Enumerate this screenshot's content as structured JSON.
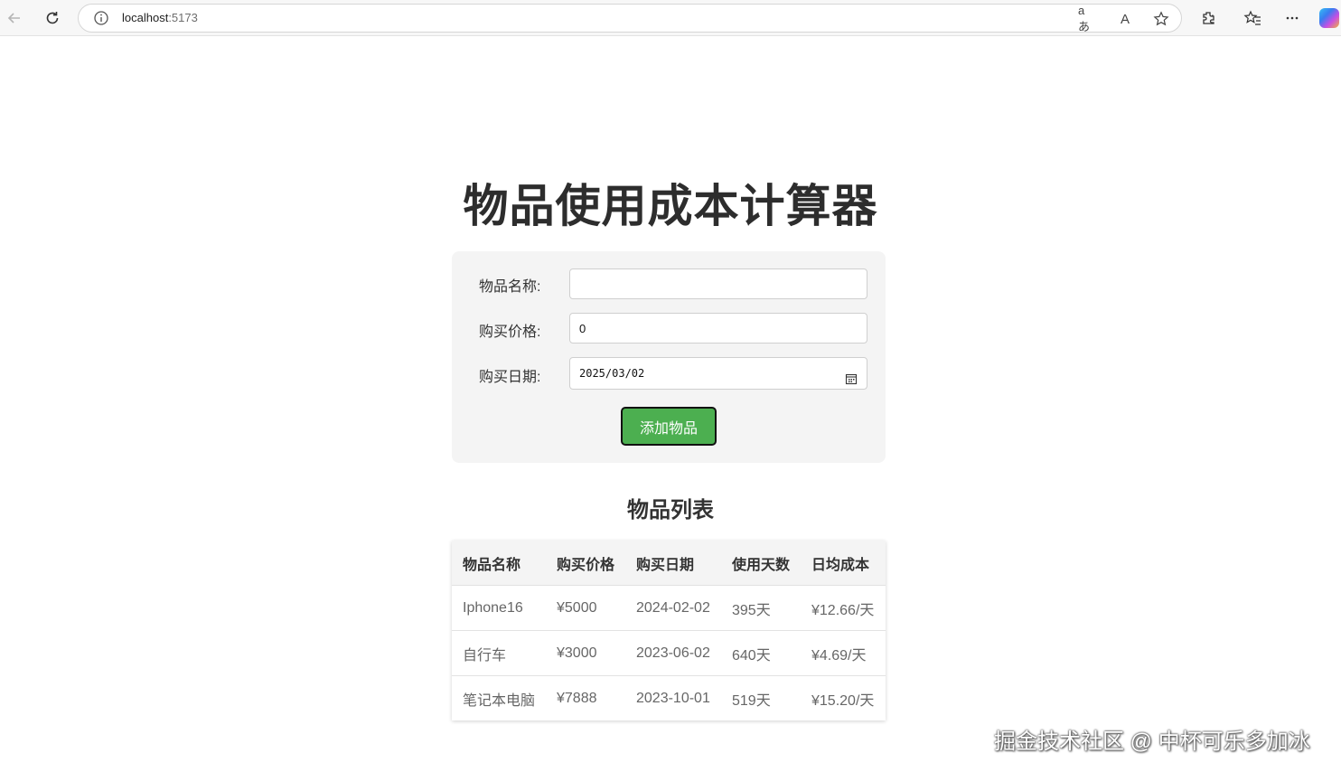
{
  "browser": {
    "url_host": "localhost",
    "url_port": ":5173",
    "translate_glyph": "aあ",
    "read_aloud_glyph": "A"
  },
  "page": {
    "title": "物品使用成本计算器",
    "form": {
      "name_label": "物品名称:",
      "name_value": "",
      "price_label": "购买价格:",
      "price_value": "0",
      "date_label": "购买日期:",
      "date_value": "2025/03/02",
      "add_button": "添加物品"
    },
    "list_title": "物品列表",
    "table": {
      "headers": [
        "物品名称",
        "购买价格",
        "购买日期",
        "使用天数",
        "日均成本"
      ],
      "rows": [
        [
          "Iphone16",
          "¥5000",
          "2024-02-02",
          "395天",
          "¥12.66/天"
        ],
        [
          "自行车",
          "¥3000",
          "2023-06-02",
          "640天",
          "¥4.69/天"
        ],
        [
          "笔记本电脑",
          "¥7888",
          "2023-10-01",
          "519天",
          "¥15.20/天"
        ]
      ]
    }
  },
  "watermark": "掘金技术社区 @ 中杯可乐多加冰"
}
